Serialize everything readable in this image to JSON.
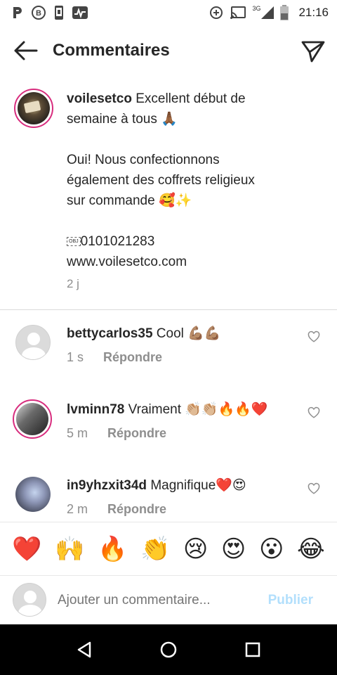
{
  "status": {
    "time": "21:16",
    "network": "3G",
    "icons": [
      "p-icon",
      "b-icon",
      "phone-icon",
      "activity-icon",
      "data-saver-icon",
      "cast-icon",
      "signal-icon",
      "battery-icon"
    ]
  },
  "header": {
    "title": "Commentaires"
  },
  "caption": {
    "username": "voilesetco",
    "lines": [
      "Excellent début de",
      "semaine à tous 🙏🏾",
      "",
      "Oui! Nous confectionnons",
      "également des coffrets religieux",
      "sur commande 🥰✨",
      "",
      "0101021283",
      "www.voilesetco.com"
    ],
    "time": "2 j"
  },
  "comments": [
    {
      "username": "bettycarlos35",
      "text": "Cool 💪🏽💪🏽",
      "time": "1 s",
      "reply": "Répondre"
    },
    {
      "username": "lvminn78",
      "text": "Vraiment 👏🏼👏🏼🔥🔥❤️",
      "time": "5 m",
      "reply": "Répondre"
    },
    {
      "username": "in9yhzxit34d",
      "text": "Magnifique❤️😍",
      "time": "2 m",
      "reply": "Répondre"
    }
  ],
  "emojis": [
    "❤️",
    "🙌",
    "🔥",
    "👏",
    "😢",
    "😍",
    "😮",
    "😂"
  ],
  "input": {
    "placeholder": "Ajouter un commentaire...",
    "post_label": "Publier"
  },
  "colors": {
    "accent_disabled": "#b2dffc",
    "story_ring": "#d82d7e",
    "meta": "#8e8e8e"
  }
}
